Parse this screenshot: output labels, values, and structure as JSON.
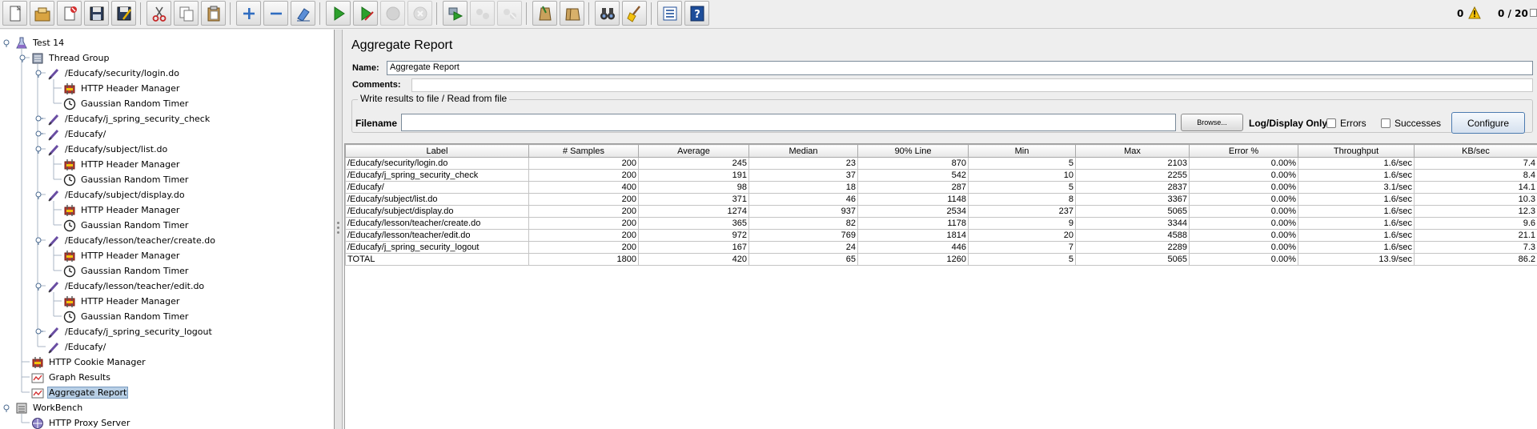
{
  "toolbar": {
    "buttons": [
      {
        "name": "new-button",
        "icon": "new-icon"
      },
      {
        "name": "templates-button",
        "icon": "templates-icon"
      },
      {
        "name": "open-button",
        "icon": "open-icon"
      },
      {
        "name": "save-button",
        "icon": "save-icon"
      },
      {
        "name": "save-as-button",
        "icon": "save-as-icon"
      },
      {
        "name": "cut-button",
        "icon": "cut-icon"
      },
      {
        "name": "copy-button",
        "icon": "copy-icon"
      },
      {
        "name": "paste-button",
        "icon": "paste-icon"
      },
      {
        "name": "expand-button",
        "icon": "plus-icon"
      },
      {
        "name": "collapse-button",
        "icon": "minus-icon"
      },
      {
        "name": "toggle-button",
        "icon": "toggle-icon"
      },
      {
        "name": "start-button",
        "icon": "play-icon"
      },
      {
        "name": "start-no-pauses-button",
        "icon": "play-no-timers-icon"
      },
      {
        "name": "stop-button",
        "icon": "stop-icon",
        "disabled": true
      },
      {
        "name": "shutdown-button",
        "icon": "shutdown-icon",
        "disabled": true
      },
      {
        "name": "remote-start-button",
        "icon": "remote-start-icon"
      },
      {
        "name": "remote-stop-button",
        "icon": "remote-stop-icon",
        "disabled": true
      },
      {
        "name": "remote-shutdown-button",
        "icon": "remote-shutdown-icon",
        "disabled": true
      },
      {
        "name": "clear-button",
        "icon": "clear-icon"
      },
      {
        "name": "clear-all-button",
        "icon": "clear-all-icon"
      },
      {
        "name": "search-button",
        "icon": "binoculars-icon"
      },
      {
        "name": "reset-search-button",
        "icon": "broom-icon"
      },
      {
        "name": "function-helper-button",
        "icon": "list-icon"
      },
      {
        "name": "help-button",
        "icon": "help-icon"
      }
    ],
    "error_count": "0",
    "thread_status": "0 / 20"
  },
  "tree": [
    {
      "label": "Test 14",
      "icon": "test-plan-icon",
      "level": 0
    },
    {
      "label": "Thread Group",
      "icon": "thread-group-icon",
      "level": 1
    },
    {
      "label": "/Educafy/security/login.do",
      "icon": "sampler-icon",
      "level": 2
    },
    {
      "label": "HTTP Header Manager",
      "icon": "config-icon",
      "level": 3
    },
    {
      "label": "Gaussian Random Timer",
      "icon": "timer-icon",
      "level": 3
    },
    {
      "label": "/Educafy/j_spring_security_check",
      "icon": "sampler-icon",
      "level": 2
    },
    {
      "label": "/Educafy/",
      "icon": "sampler-icon",
      "level": 2
    },
    {
      "label": "/Educafy/subject/list.do",
      "icon": "sampler-icon",
      "level": 2
    },
    {
      "label": "HTTP Header Manager",
      "icon": "config-icon",
      "level": 3
    },
    {
      "label": "Gaussian Random Timer",
      "icon": "timer-icon",
      "level": 3
    },
    {
      "label": "/Educafy/subject/display.do",
      "icon": "sampler-icon",
      "level": 2
    },
    {
      "label": "HTTP Header Manager",
      "icon": "config-icon",
      "level": 3
    },
    {
      "label": "Gaussian Random Timer",
      "icon": "timer-icon",
      "level": 3
    },
    {
      "label": "/Educafy/lesson/teacher/create.do",
      "icon": "sampler-icon",
      "level": 2
    },
    {
      "label": "HTTP Header Manager",
      "icon": "config-icon",
      "level": 3
    },
    {
      "label": "Gaussian Random Timer",
      "icon": "timer-icon",
      "level": 3
    },
    {
      "label": "/Educafy/lesson/teacher/edit.do",
      "icon": "sampler-icon",
      "level": 2
    },
    {
      "label": "HTTP Header Manager",
      "icon": "config-icon",
      "level": 3
    },
    {
      "label": "Gaussian Random Timer",
      "icon": "timer-icon",
      "level": 3
    },
    {
      "label": "/Educafy/j_spring_security_logout",
      "icon": "sampler-icon",
      "level": 2
    },
    {
      "label": "/Educafy/",
      "icon": "sampler-icon",
      "level": 2
    },
    {
      "label": "HTTP Cookie Manager",
      "icon": "config-icon",
      "level": 1
    },
    {
      "label": "Graph Results",
      "icon": "listener-icon",
      "level": 1
    },
    {
      "label": "Aggregate Report",
      "icon": "listener-icon",
      "level": 1,
      "selected": true
    },
    {
      "label": "WorkBench",
      "icon": "workbench-icon",
      "level": 0
    },
    {
      "label": "HTTP Proxy Server",
      "icon": "proxy-icon",
      "level": 1
    }
  ],
  "report": {
    "title": "Aggregate Report",
    "name_label": "Name:",
    "name_value": "Aggregate Report",
    "comments_label": "Comments:",
    "file_group_title": "Write results to file / Read from file",
    "filename_label": "Filename",
    "browse_label": "Browse...",
    "log_display_label": "Log/Display Only:",
    "errors_label": "Errors",
    "successes_label": "Successes",
    "configure_label": "Configure"
  },
  "table": {
    "columns": [
      "Label",
      "# Samples",
      "Average",
      "Median",
      "90% Line",
      "Min",
      "Max",
      "Error %",
      "Throughput",
      "KB/sec"
    ],
    "rows": [
      [
        "/Educafy/security/login.do",
        "200",
        "245",
        "23",
        "870",
        "5",
        "2103",
        "0.00%",
        "1.6/sec",
        "7.4"
      ],
      [
        "/Educafy/j_spring_security_check",
        "200",
        "191",
        "37",
        "542",
        "10",
        "2255",
        "0.00%",
        "1.6/sec",
        "8.4"
      ],
      [
        "/Educafy/",
        "400",
        "98",
        "18",
        "287",
        "5",
        "2837",
        "0.00%",
        "3.1/sec",
        "14.1"
      ],
      [
        "/Educafy/subject/list.do",
        "200",
        "371",
        "46",
        "1148",
        "8",
        "3367",
        "0.00%",
        "1.6/sec",
        "10.3"
      ],
      [
        "/Educafy/subject/display.do",
        "200",
        "1274",
        "937",
        "2534",
        "237",
        "5065",
        "0.00%",
        "1.6/sec",
        "12.3"
      ],
      [
        "/Educafy/lesson/teacher/create.do",
        "200",
        "365",
        "82",
        "1178",
        "9",
        "3344",
        "0.00%",
        "1.6/sec",
        "9.6"
      ],
      [
        "/Educafy/lesson/teacher/edit.do",
        "200",
        "972",
        "769",
        "1814",
        "20",
        "4588",
        "0.00%",
        "1.6/sec",
        "21.1"
      ],
      [
        "/Educafy/j_spring_security_logout",
        "200",
        "167",
        "24",
        "446",
        "7",
        "2289",
        "0.00%",
        "1.6/sec",
        "7.3"
      ],
      [
        "TOTAL",
        "1800",
        "420",
        "65",
        "1260",
        "5",
        "5065",
        "0.00%",
        "13.9/sec",
        "86.2"
      ]
    ]
  },
  "colors": {
    "selection": "#b8cfe5",
    "play_green": "#2ca02c",
    "warning_yellow": "#f4c20d"
  }
}
